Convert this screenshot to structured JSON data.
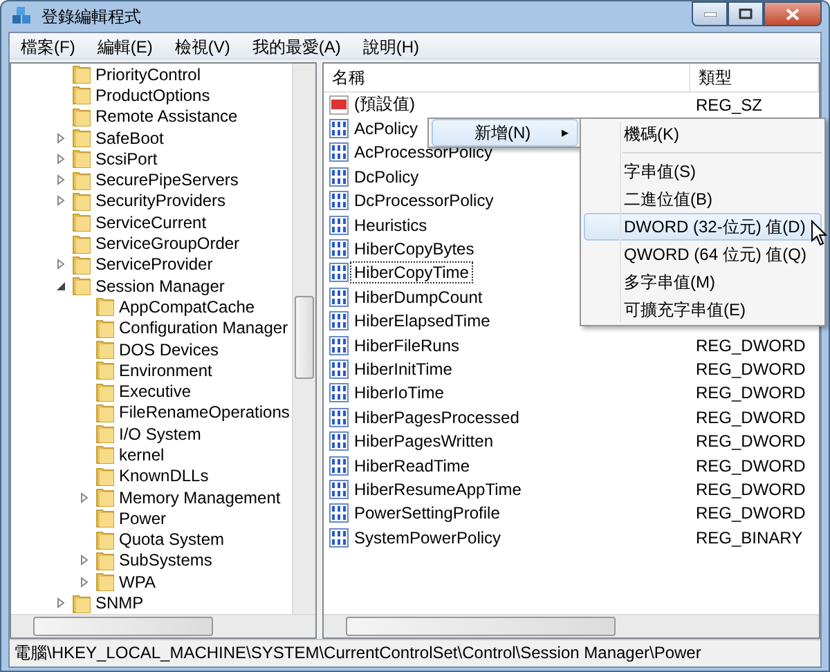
{
  "window": {
    "title": "登錄編輯程式"
  },
  "menu": [
    "檔案(F)",
    "編輯(E)",
    "檢視(V)",
    "我的最愛(A)",
    "說明(H)"
  ],
  "tree": [
    {
      "label": "PriorityControl"
    },
    {
      "label": "ProductOptions"
    },
    {
      "label": "Remote Assistance"
    },
    {
      "label": "SafeBoot",
      "expanded": false
    },
    {
      "label": "ScsiPort",
      "expanded": false
    },
    {
      "label": "SecurePipeServers",
      "expanded": false
    },
    {
      "label": "SecurityProviders",
      "expanded": false
    },
    {
      "label": "ServiceCurrent"
    },
    {
      "label": "ServiceGroupOrder"
    },
    {
      "label": "ServiceProvider",
      "expanded": false
    },
    {
      "label": "Session Manager",
      "expanded": true,
      "children": [
        {
          "label": "AppCompatCache"
        },
        {
          "label": "Configuration Manager"
        },
        {
          "label": "DOS Devices"
        },
        {
          "label": "Environment"
        },
        {
          "label": "Executive"
        },
        {
          "label": "FileRenameOperations"
        },
        {
          "label": "I/O System"
        },
        {
          "label": "kernel"
        },
        {
          "label": "KnownDLLs"
        },
        {
          "label": "Memory Management",
          "expanded": false
        },
        {
          "label": "Power"
        },
        {
          "label": "Quota System"
        },
        {
          "label": "SubSystems",
          "expanded": false
        },
        {
          "label": "WPA",
          "expanded": false
        }
      ]
    },
    {
      "label": "SNMP",
      "expanded": false
    }
  ],
  "columns": [
    "名稱",
    "類型"
  ],
  "values": [
    {
      "name": "(預設值)",
      "type": "REG_SZ",
      "kind": "string",
      "selected": false
    },
    {
      "name": "AcPolicy",
      "kind": "number",
      "selected": false
    },
    {
      "name": "AcProcessorPolicy",
      "kind": "number",
      "selected": false
    },
    {
      "name": "DcPolicy",
      "kind": "number",
      "selected": false
    },
    {
      "name": "DcProcessorPolicy",
      "kind": "number",
      "selected": false
    },
    {
      "name": "Heuristics",
      "kind": "number",
      "selected": false
    },
    {
      "name": "HiberCopyBytes",
      "kind": "number",
      "selected": false
    },
    {
      "name": "HiberCopyTime",
      "kind": "number",
      "selected": true
    },
    {
      "name": "HiberDumpCount",
      "kind": "number",
      "selected": false
    },
    {
      "name": "HiberElapsedTime",
      "kind": "number",
      "selected": false
    },
    {
      "name": "HiberFileRuns",
      "type": "REG_DWORD",
      "kind": "number",
      "selected": false
    },
    {
      "name": "HiberInitTime",
      "type": "REG_DWORD",
      "kind": "number",
      "selected": false
    },
    {
      "name": "HiberIoTime",
      "type": "REG_DWORD",
      "kind": "number",
      "selected": false
    },
    {
      "name": "HiberPagesProcessed",
      "type": "REG_DWORD",
      "kind": "number",
      "selected": false
    },
    {
      "name": "HiberPagesWritten",
      "type": "REG_DWORD",
      "kind": "number",
      "selected": false
    },
    {
      "name": "HiberReadTime",
      "type": "REG_DWORD",
      "kind": "number",
      "selected": false
    },
    {
      "name": "HiberResumeAppTime",
      "type": "REG_DWORD",
      "kind": "number",
      "selected": false
    },
    {
      "name": "PowerSettingProfile",
      "type": "REG_DWORD",
      "kind": "number",
      "selected": false
    },
    {
      "name": "SystemPowerPolicy",
      "type": "REG_BINARY",
      "kind": "number",
      "selected": false
    }
  ],
  "context_menu": {
    "label": "新增(N)",
    "arrow": "▸"
  },
  "submenu": [
    {
      "kind": "item",
      "label": "機碼(K)",
      "selected": false
    },
    {
      "kind": "separator"
    },
    {
      "kind": "item",
      "label": "字串值(S)",
      "selected": false
    },
    {
      "kind": "item",
      "label": "二進位值(B)",
      "selected": false
    },
    {
      "kind": "item",
      "label": "DWORD (32-位元) 值(D)",
      "selected": true
    },
    {
      "kind": "item",
      "label": "QWORD (64 位元) 值(Q)",
      "selected": false
    },
    {
      "kind": "item",
      "label": "多字串值(M)",
      "selected": false
    },
    {
      "kind": "item",
      "label": "可擴充字串值(E)",
      "selected": false
    }
  ],
  "status_bar": "電腦\\HKEY_LOCAL_MACHINE\\SYSTEM\\CurrentControlSet\\Control\\Session Manager\\Power"
}
